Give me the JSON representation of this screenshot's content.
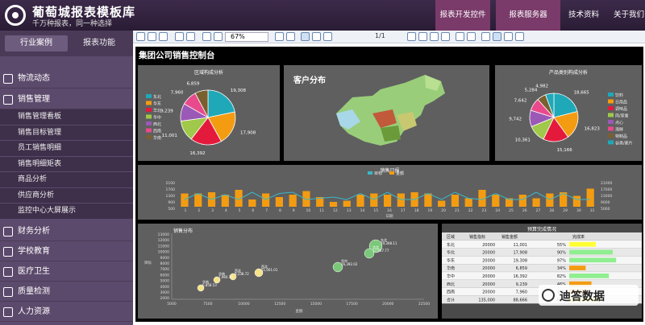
{
  "header": {
    "title": "葡萄城报表模板库",
    "subtitle": "千万种报表，同一种选择",
    "nav": [
      "报表开发控件",
      "报表服务器",
      "技术资料",
      "关于我们"
    ]
  },
  "sidebar": {
    "tabs": [
      "行业案例",
      "报表功能"
    ],
    "categories": [
      "物流动态",
      "销售管理",
      "财务分析",
      "学校教育",
      "医疗卫生",
      "质量检测",
      "人力资源"
    ],
    "sales_items": [
      "销售管理看板",
      "销售目标管理",
      "员工销售明细",
      "销售明细矩表",
      "商品分析",
      "供应商分析",
      "监控中心大屏展示"
    ]
  },
  "toolbar": {
    "zoom": "67%",
    "page": "1/1"
  },
  "dashboard": {
    "title": "集团公司销售控制台"
  },
  "colors": {
    "pie": [
      "#1fa8b8",
      "#f39c12",
      "#e41a3c",
      "#a0c84a",
      "#9b59b6",
      "#e84a8c",
      "#7a6030"
    ]
  },
  "region_pie": {
    "title": "区域构成分析",
    "legend": [
      "东北",
      "华东",
      "华北",
      "华中",
      "西北",
      "西南",
      "华南"
    ],
    "labels": [
      "19,308",
      "17,908",
      "16,392",
      "11,001",
      "9,239",
      "7,960",
      "6,859"
    ],
    "values": [
      19308,
      17908,
      16392,
      11001,
      9239,
      7960,
      6859
    ]
  },
  "map": {
    "title": "客户分布"
  },
  "product_pie": {
    "title": "产品类别构成分析",
    "legend": [
      "饮料",
      "日用品",
      "调味品",
      "肉/家禽",
      "点心",
      "海鲜",
      "特制品",
      "谷类/麦片"
    ],
    "labels": [
      "18,665",
      "16,823",
      "15,166",
      "10,361",
      "9,742",
      "7,642",
      "5,284",
      "4,982"
    ],
    "values": [
      18665,
      16823,
      15166,
      10361,
      9742,
      7642,
      5284,
      4982
    ]
  },
  "trend": {
    "title": "销售日报",
    "legend": [
      "目标",
      "金额"
    ],
    "xlabel": "日期",
    "left_ticks": [
      "2100",
      "1700",
      "1300",
      "900",
      "500"
    ],
    "right_ticks": [
      "21000",
      "17000",
      "13000",
      "9000",
      "5000"
    ],
    "days": [
      "1",
      "2",
      "3",
      "4",
      "5",
      "6",
      "7",
      "8",
      "9",
      "10",
      "11",
      "12",
      "13",
      "14",
      "15",
      "16",
      "17",
      "18",
      "19",
      "20",
      "21",
      "22",
      "23",
      "24",
      "25",
      "26",
      "27",
      "28",
      "29",
      "30",
      "31"
    ]
  },
  "bubble": {
    "title": "销售分布",
    "xlabel": "金额",
    "ylabel": "目标",
    "xticks": [
      "5000",
      "7500",
      "10000",
      "12500",
      "15000",
      "17500",
      "20000",
      "22500"
    ],
    "yticks": [
      "13000",
      "12000",
      "11000",
      "10000",
      "9000",
      "8000",
      "7000",
      "6000",
      "5000",
      "4000",
      "3000",
      "2000"
    ],
    "points": [
      {
        "name": "东北",
        "label": "19,308.11"
      },
      {
        "name": "华北",
        "label": "17,907.77"
      },
      {
        "name": "华中",
        "label": "16,392.02"
      },
      {
        "name": "西北",
        "label": "11,001.01"
      },
      {
        "name": "西北",
        "label": "9,238.72"
      },
      {
        "name": "华南",
        "label": "7,960.19"
      },
      {
        "name": "华南",
        "label": "6,858.53"
      }
    ]
  },
  "table": {
    "title": "预算完成情况",
    "headers": [
      "区域",
      "销售指标",
      "销售金额",
      "",
      "完成率"
    ],
    "rows": [
      [
        "东北",
        "20000",
        "11,001",
        "55%"
      ],
      [
        "华北",
        "20000",
        "17,908",
        "90%"
      ],
      [
        "华东",
        "20000",
        "19,308",
        "97%"
      ],
      [
        "华南",
        "20000",
        "6,859",
        "34%"
      ],
      [
        "华中",
        "20000",
        "16,392",
        "82%"
      ],
      [
        "西北",
        "20000",
        "9,239",
        "46%"
      ],
      [
        "西南",
        "20000",
        "7,960",
        "40%"
      ]
    ],
    "total": [
      "合计",
      "135,000",
      "88,666",
      "66%"
    ],
    "rates": [
      55,
      90,
      97,
      34,
      82,
      46,
      40,
      66
    ]
  },
  "watermark": "迪答数据"
}
